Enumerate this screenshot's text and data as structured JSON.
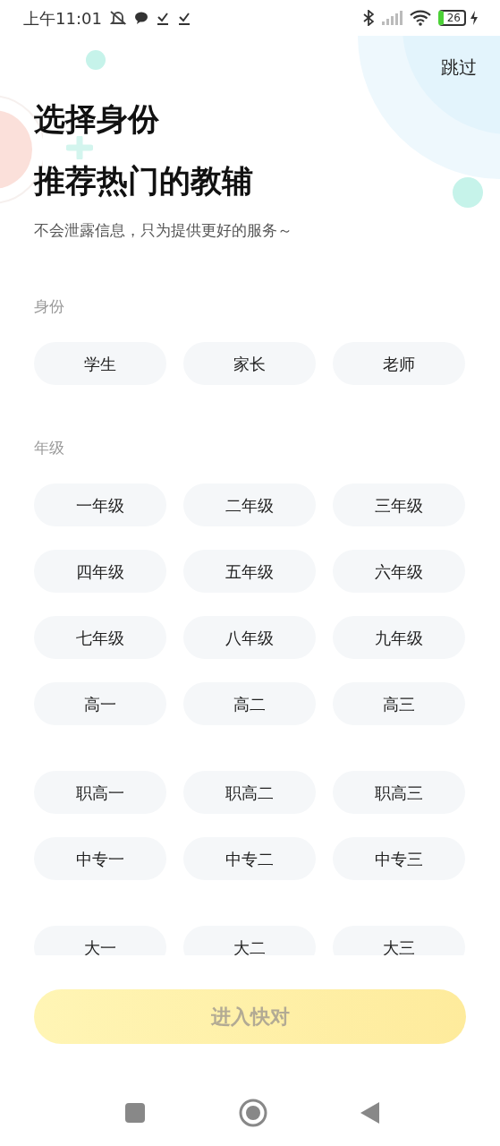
{
  "status_bar": {
    "time": "上午11:01",
    "battery": "26"
  },
  "skip": "跳过",
  "titles": [
    "选择身份",
    "推荐热门的教辅"
  ],
  "subtitle": "不会泄露信息，只为提供更好的服务～",
  "identity": {
    "label": "身份",
    "options": [
      {
        "label": "学生",
        "selected": false
      },
      {
        "label": "家长",
        "selected": false
      },
      {
        "label": "老师",
        "selected": false
      }
    ]
  },
  "grade": {
    "label": "年级",
    "groups": [
      [
        {
          "label": "一年级",
          "selected": false
        },
        {
          "label": "二年级",
          "selected": false
        },
        {
          "label": "三年级",
          "selected": false
        },
        {
          "label": "四年级",
          "selected": false
        },
        {
          "label": "五年级",
          "selected": false
        },
        {
          "label": "六年级",
          "selected": false
        },
        {
          "label": "七年级",
          "selected": false
        },
        {
          "label": "八年级",
          "selected": false
        },
        {
          "label": "九年级",
          "selected": false
        },
        {
          "label": "高一",
          "selected": false
        },
        {
          "label": "高二",
          "selected": false
        },
        {
          "label": "高三",
          "selected": false
        }
      ],
      [
        {
          "label": "职高一",
          "selected": false
        },
        {
          "label": "职高二",
          "selected": false
        },
        {
          "label": "职高三",
          "selected": false
        },
        {
          "label": "中专一",
          "selected": false
        },
        {
          "label": "中专二",
          "selected": false
        },
        {
          "label": "中专三",
          "selected": false
        }
      ],
      [
        {
          "label": "大一",
          "selected": false
        },
        {
          "label": "大二",
          "selected": false
        },
        {
          "label": "大三",
          "selected": false
        }
      ]
    ]
  },
  "submit": {
    "label": "进入快对",
    "disabled": true
  }
}
